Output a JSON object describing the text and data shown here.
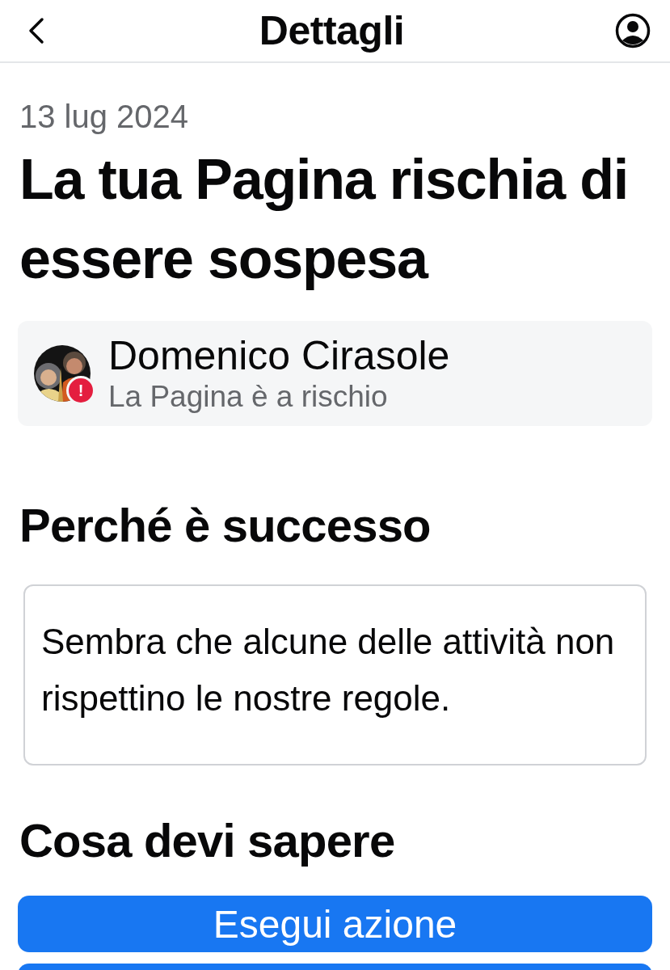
{
  "header": {
    "title": "Dettagli"
  },
  "date": "13 lug 2024",
  "title": "La tua Pagina rischia di essere sospesa",
  "page_card": {
    "name": "Domenico Cirasole",
    "status": "La Pagina è a rischio",
    "alert_badge": "!"
  },
  "sections": [
    {
      "heading": "Perché è successo",
      "body": "Sembra che alcune delle attività non rispettino le nostre regole."
    },
    {
      "heading": "Cosa devi sapere"
    }
  ],
  "actions": [
    {
      "label": "Esegui azione"
    }
  ]
}
